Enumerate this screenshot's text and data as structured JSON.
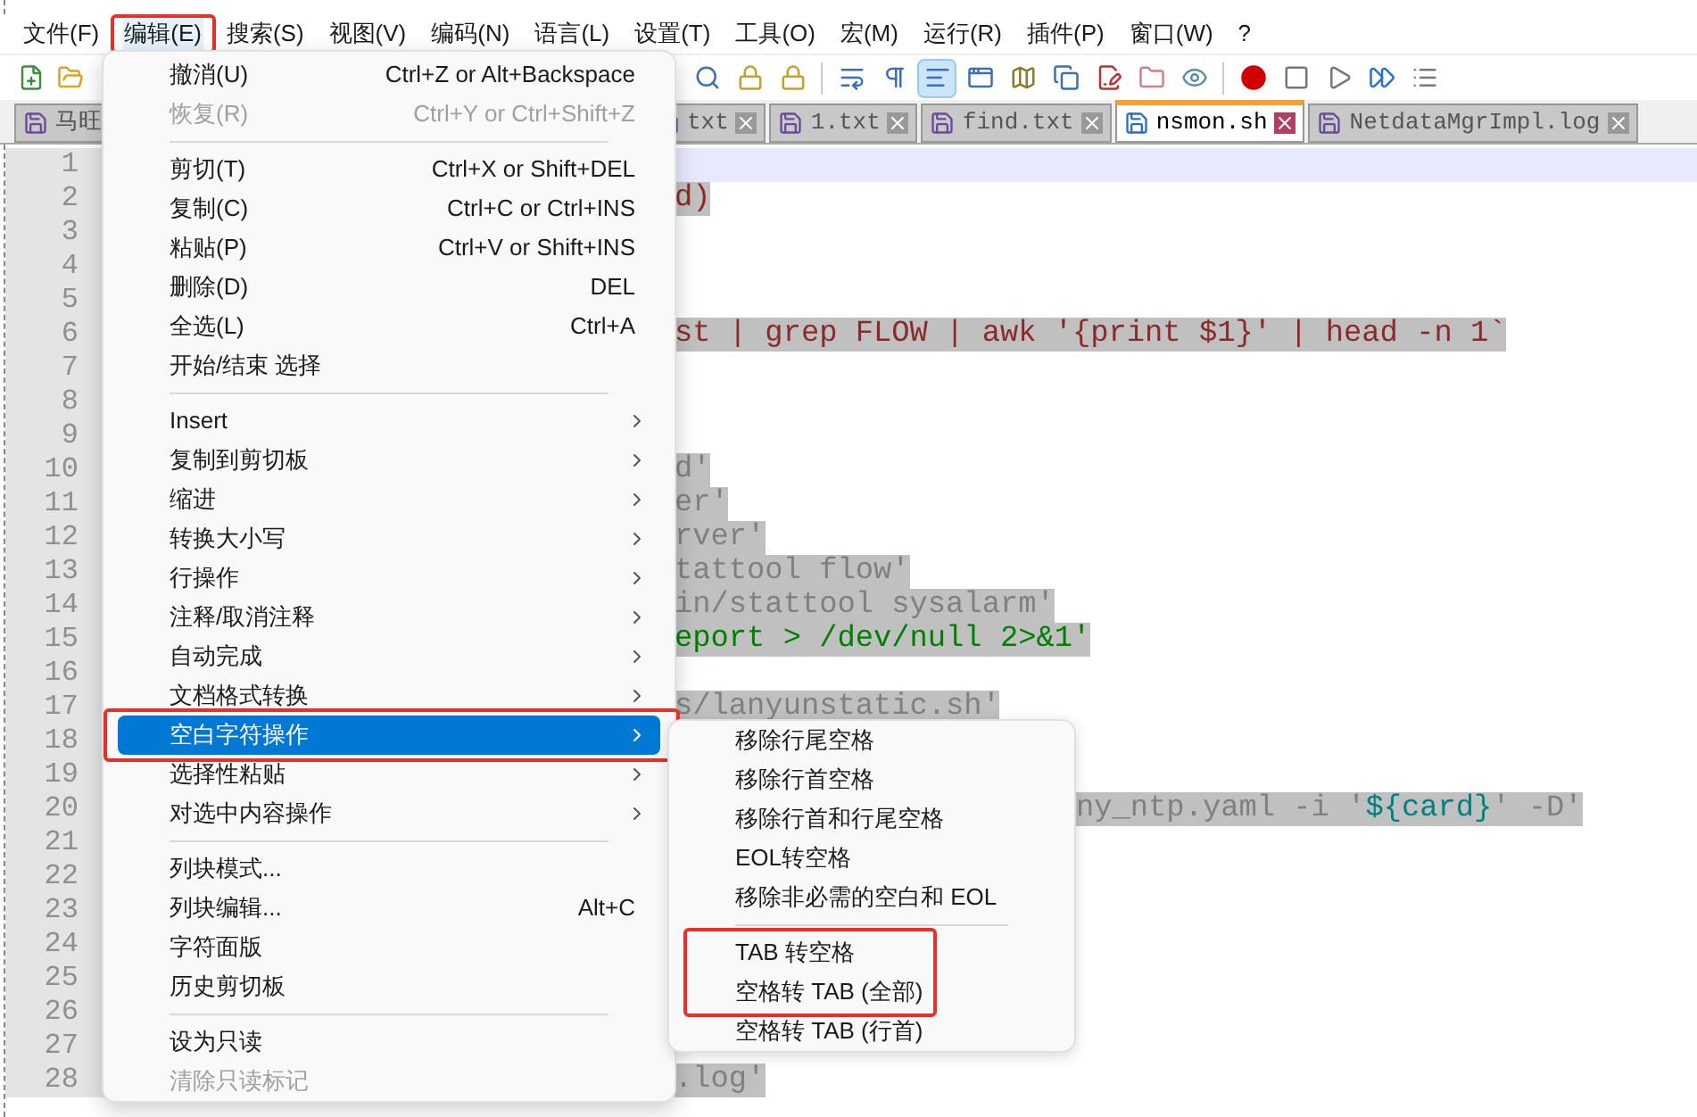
{
  "menu_bar": [
    {
      "label": "文件(F)",
      "selected": false,
      "annotated": false
    },
    {
      "label": "编辑(E)",
      "selected": true,
      "annotated": true
    },
    {
      "label": "搜索(S)",
      "selected": false,
      "annotated": false
    },
    {
      "label": "视图(V)",
      "selected": false,
      "annotated": false
    },
    {
      "label": "编码(N)",
      "selected": false,
      "annotated": false
    },
    {
      "label": "语言(L)",
      "selected": false,
      "annotated": false
    },
    {
      "label": "设置(T)",
      "selected": false,
      "annotated": false
    },
    {
      "label": "工具(O)",
      "selected": false,
      "annotated": false
    },
    {
      "label": "宏(M)",
      "selected": false,
      "annotated": false
    },
    {
      "label": "运行(R)",
      "selected": false,
      "annotated": false
    },
    {
      "label": "插件(P)",
      "selected": false,
      "annotated": false
    },
    {
      "label": "窗口(W)",
      "selected": false,
      "annotated": false
    },
    {
      "label": "?",
      "selected": false,
      "annotated": false
    }
  ],
  "tabs": [
    {
      "label": "马旺",
      "selected": false
    },
    {
      "label": "txt",
      "selected": false
    },
    {
      "label": "1.txt",
      "selected": false
    },
    {
      "label": "find.txt",
      "selected": false
    },
    {
      "label": "nsmon.sh",
      "selected": true
    },
    {
      "label": "NetdataMgrImpl.log",
      "selected": false
    }
  ],
  "editor": {
    "lines": [
      {
        "number": "1",
        "current": true
      },
      {
        "number": "2",
        "current": false,
        "selected": true,
        "under_submenu": false,
        "segments": [
          {
            "text": "d)",
            "kind": "command"
          }
        ]
      },
      {
        "number": "3",
        "current": false
      },
      {
        "number": "4",
        "current": false
      },
      {
        "number": "5",
        "current": false
      },
      {
        "number": "6",
        "current": false,
        "selected": true,
        "under_submenu": false,
        "segments": [
          {
            "text": "st | grep FLOW | awk '{print $1}' | head -n 1`",
            "kind": "command"
          }
        ]
      },
      {
        "number": "7",
        "current": false
      },
      {
        "number": "8",
        "current": false
      },
      {
        "number": "9",
        "current": false
      },
      {
        "number": "10",
        "current": false,
        "selected": true,
        "under_submenu": false,
        "segments": [
          {
            "text": "d'",
            "kind": "string"
          }
        ]
      },
      {
        "number": "11",
        "current": false,
        "selected": true,
        "under_submenu": false,
        "segments": [
          {
            "text": "er'",
            "kind": "string"
          }
        ]
      },
      {
        "number": "12",
        "current": false,
        "selected": true,
        "under_submenu": false,
        "segments": [
          {
            "text": "rver'",
            "kind": "string"
          }
        ]
      },
      {
        "number": "13",
        "current": false,
        "selected": true,
        "under_submenu": false,
        "segments": [
          {
            "text": "tattool flow'",
            "kind": "string"
          }
        ]
      },
      {
        "number": "14",
        "current": false,
        "selected": true,
        "under_submenu": false,
        "segments": [
          {
            "text": "in/stattool sysalarm'",
            "kind": "string"
          }
        ]
      },
      {
        "number": "15",
        "current": false,
        "selected": true,
        "under_submenu": false,
        "segments": [
          {
            "text": "eport > /dev/null 2>&1'",
            "kind": "redirect"
          }
        ]
      },
      {
        "number": "16",
        "current": false
      },
      {
        "number": "17",
        "current": false,
        "selected": true,
        "under_submenu": false,
        "segments": [
          {
            "text": "s/lanyunstatic.sh'",
            "kind": "string"
          }
        ]
      },
      {
        "number": "18",
        "current": false
      },
      {
        "number": "19",
        "current": false
      },
      {
        "number": "20",
        "current": false,
        "selected": true,
        "under_submenu": true,
        "segments": [
          {
            "text": "ny_ntp.yaml -i '",
            "kind": "string"
          },
          {
            "text": "${card}",
            "kind": "variable"
          },
          {
            "text": "' -D'",
            "kind": "string"
          }
        ]
      },
      {
        "number": "21",
        "current": false
      },
      {
        "number": "22",
        "current": false
      },
      {
        "number": "23",
        "current": false
      },
      {
        "number": "24",
        "current": false
      },
      {
        "number": "25",
        "current": false
      },
      {
        "number": "26",
        "current": false
      },
      {
        "number": "27",
        "current": false
      },
      {
        "number": "28",
        "current": false,
        "selected": true,
        "under_submenu": false,
        "segments": [
          {
            "text": ".log'",
            "kind": "string"
          }
        ]
      }
    ]
  },
  "edit_menu": {
    "items": [
      {
        "kind": "item",
        "label": "撤消(U)",
        "shortcut": "Ctrl+Z or Alt+Backspace",
        "disabled": false,
        "submenu": false,
        "selected": false,
        "annotated": false
      },
      {
        "kind": "item",
        "label": "恢复(R)",
        "shortcut": "Ctrl+Y or Ctrl+Shift+Z",
        "disabled": true,
        "submenu": false,
        "selected": false,
        "annotated": false
      },
      {
        "kind": "separator"
      },
      {
        "kind": "item",
        "label": "剪切(T)",
        "shortcut": "Ctrl+X or Shift+DEL",
        "disabled": false,
        "submenu": false,
        "selected": false,
        "annotated": false
      },
      {
        "kind": "item",
        "label": "复制(C)",
        "shortcut": "Ctrl+C or Ctrl+INS",
        "disabled": false,
        "submenu": false,
        "selected": false,
        "annotated": false
      },
      {
        "kind": "item",
        "label": "粘贴(P)",
        "shortcut": "Ctrl+V or Shift+INS",
        "disabled": false,
        "submenu": false,
        "selected": false,
        "annotated": false
      },
      {
        "kind": "item",
        "label": "删除(D)",
        "shortcut": "DEL",
        "disabled": false,
        "submenu": false,
        "selected": false,
        "annotated": false
      },
      {
        "kind": "item",
        "label": "全选(L)",
        "shortcut": "Ctrl+A",
        "disabled": false,
        "submenu": false,
        "selected": false,
        "annotated": false
      },
      {
        "kind": "item",
        "label": "开始/结束 选择",
        "disabled": false,
        "submenu": false,
        "selected": false,
        "annotated": false
      },
      {
        "kind": "separator"
      },
      {
        "kind": "item",
        "label": "Insert",
        "disabled": false,
        "submenu": true,
        "selected": false,
        "annotated": false
      },
      {
        "kind": "item",
        "label": "复制到剪切板",
        "disabled": false,
        "submenu": true,
        "selected": false,
        "annotated": false
      },
      {
        "kind": "item",
        "label": "缩进",
        "disabled": false,
        "submenu": true,
        "selected": false,
        "annotated": false
      },
      {
        "kind": "item",
        "label": "转换大小写",
        "disabled": false,
        "submenu": true,
        "selected": false,
        "annotated": false
      },
      {
        "kind": "item",
        "label": "行操作",
        "disabled": false,
        "submenu": true,
        "selected": false,
        "annotated": false
      },
      {
        "kind": "item",
        "label": "注释/取消注释",
        "disabled": false,
        "submenu": true,
        "selected": false,
        "annotated": false
      },
      {
        "kind": "item",
        "label": "自动完成",
        "disabled": false,
        "submenu": true,
        "selected": false,
        "annotated": false
      },
      {
        "kind": "item",
        "label": "文档格式转换",
        "disabled": false,
        "submenu": true,
        "selected": false,
        "annotated": false
      },
      {
        "kind": "item",
        "label": "空白字符操作",
        "disabled": false,
        "submenu": true,
        "selected": true,
        "annotated": true
      },
      {
        "kind": "item",
        "label": "选择性粘贴",
        "disabled": false,
        "submenu": true,
        "selected": false,
        "annotated": false
      },
      {
        "kind": "item",
        "label": "对选中内容操作",
        "disabled": false,
        "submenu": true,
        "selected": false,
        "annotated": false
      },
      {
        "kind": "separator"
      },
      {
        "kind": "item",
        "label": "列块模式...",
        "disabled": false,
        "submenu": false,
        "selected": false,
        "annotated": false
      },
      {
        "kind": "item",
        "label": "列块编辑...",
        "shortcut": "Alt+C",
        "disabled": false,
        "submenu": false,
        "selected": false,
        "annotated": false
      },
      {
        "kind": "item",
        "label": "字符面版",
        "disabled": false,
        "submenu": false,
        "selected": false,
        "annotated": false
      },
      {
        "kind": "item",
        "label": "历史剪切板",
        "disabled": false,
        "submenu": false,
        "selected": false,
        "annotated": false
      },
      {
        "kind": "separator"
      },
      {
        "kind": "item",
        "label": "设为只读",
        "disabled": false,
        "submenu": false,
        "selected": false,
        "annotated": false
      },
      {
        "kind": "item",
        "label": "清除只读标记",
        "disabled": true,
        "submenu": false,
        "selected": false,
        "annotated": false
      }
    ],
    "submenu": {
      "items": [
        {
          "kind": "item",
          "label": "移除行尾空格",
          "annotated": false
        },
        {
          "kind": "item",
          "label": "移除行首空格",
          "annotated": false
        },
        {
          "kind": "item",
          "label": "移除行首和行尾空格",
          "annotated": false
        },
        {
          "kind": "item",
          "label": "EOL转空格",
          "annotated": false
        },
        {
          "kind": "item",
          "label": "移除非必需的空白和 EOL",
          "annotated": false
        },
        {
          "kind": "separator"
        },
        {
          "kind": "item",
          "label": "TAB 转空格",
          "annotated": true
        },
        {
          "kind": "item",
          "label": "空格转 TAB (全部)",
          "annotated": true
        },
        {
          "kind": "item",
          "label": "空格转 TAB (行首)",
          "annotated": false
        }
      ]
    }
  }
}
